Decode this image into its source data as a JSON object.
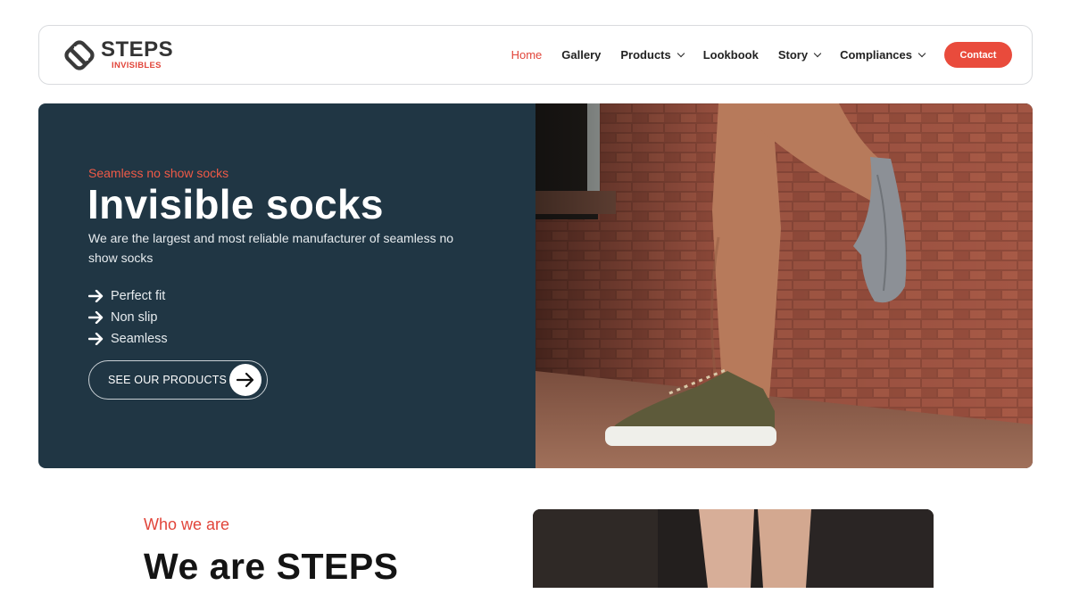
{
  "brand": {
    "name": "STEPS",
    "tagline": "INVISIBLES",
    "accent_color": "#e1453a",
    "logo_icon": "steps-logo-mark"
  },
  "nav": {
    "items": [
      {
        "label": "Home",
        "active": true,
        "dropdown": false
      },
      {
        "label": "Gallery",
        "active": false,
        "dropdown": false
      },
      {
        "label": "Products",
        "active": false,
        "dropdown": true
      },
      {
        "label": "Lookbook",
        "active": false,
        "dropdown": false
      },
      {
        "label": "Story",
        "active": false,
        "dropdown": true
      },
      {
        "label": "Compliances",
        "active": false,
        "dropdown": true
      }
    ],
    "contact_label": "Contact",
    "dropdown_icon": "chevron-down-icon"
  },
  "hero": {
    "eyebrow": "Seamless no show socks",
    "title": "Invisible socks",
    "description": "We are the largest and most reliable manufacturer of seamless no show socks",
    "features": [
      "Perfect fit",
      "Non slip",
      "Seamless"
    ],
    "feature_icon": "arrow-right-icon",
    "cta_label": "SEE OUR PRODUCTS",
    "cta_icon": "arrow-right-icon",
    "background_color": "#203644",
    "image": "leg-with-no-show-sock-against-brick-wall"
  },
  "who": {
    "eyebrow": "Who we are",
    "title": "We are STEPS",
    "image": "legs-photo"
  }
}
